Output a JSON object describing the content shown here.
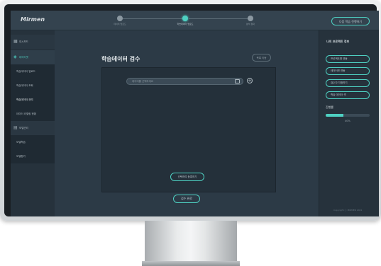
{
  "app": {
    "logo": "Mirmen",
    "top_button": "다음 학습 진행하기"
  },
  "steps": [
    {
      "label": "데이터 업로드"
    },
    {
      "label": "학습데이터 업로드"
    },
    {
      "label": "분석 결과"
    }
  ],
  "sidebar": {
    "items": [
      {
        "icon": "grid-icon",
        "label": "대시보드"
      },
      {
        "icon": "tag-icon",
        "label": "데이터셋"
      },
      {
        "label": "학습데이터 업로드"
      },
      {
        "label": "학습데이터 조회"
      },
      {
        "label": "학습데이터 관리"
      },
      {
        "label": "데이터 라벨링 현황"
      },
      {
        "icon": "chart-icon",
        "label": "모델관리"
      },
      {
        "label": "모델학습"
      },
      {
        "label": "모델평가"
      }
    ]
  },
  "main": {
    "title": "학습데이터 검수",
    "small_button": "목록 이동",
    "search_placeholder": "데이터를 선택하세요",
    "panel_button": "선택하여 등록하기",
    "bottom_button": "검수 완료"
  },
  "right": {
    "title": "나의 프로젝트 정보",
    "pills": [
      "프로젝트명 연동",
      "데이터셋 연동",
      "검수자 지정하기",
      "학습 데이터 셋"
    ],
    "progress_label": "진행률",
    "progress_value": 40,
    "progress_text": "40%",
    "copyright": "Copyright ⓒ MIRMEN 2021"
  },
  "colors": {
    "accent": "#4ed0c2",
    "background": "#2c3a46"
  }
}
